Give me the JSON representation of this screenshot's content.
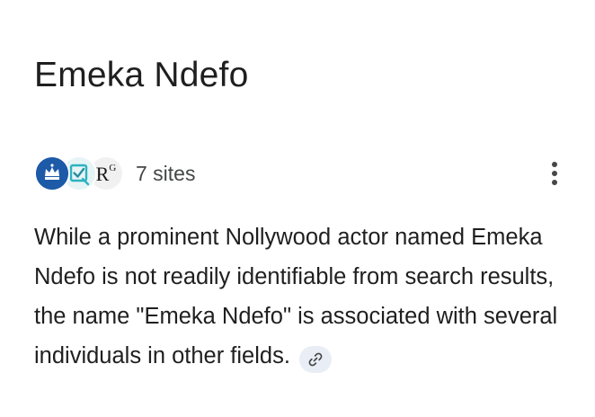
{
  "result": {
    "title": "Emeka Ndefo",
    "sources": {
      "count_label": "7 sites",
      "favicons": [
        {
          "icon": "crown-crest-icon",
          "color": "#1d5aa8"
        },
        {
          "icon": "checkbox-document-icon",
          "color": "#2bb3c0"
        },
        {
          "icon": "researchgate-icon",
          "text": "R",
          "superscript": "G"
        }
      ]
    },
    "more_icon": "more-vert-icon",
    "answer_text": "While a prominent Nollywood actor named Emeka Ndefo is not readily identifiable from search results, the name \"Emeka Ndefo\" is associated with several individuals in other fields.",
    "link_icon": "link-icon",
    "link_chip_color": "#e9eef6"
  }
}
